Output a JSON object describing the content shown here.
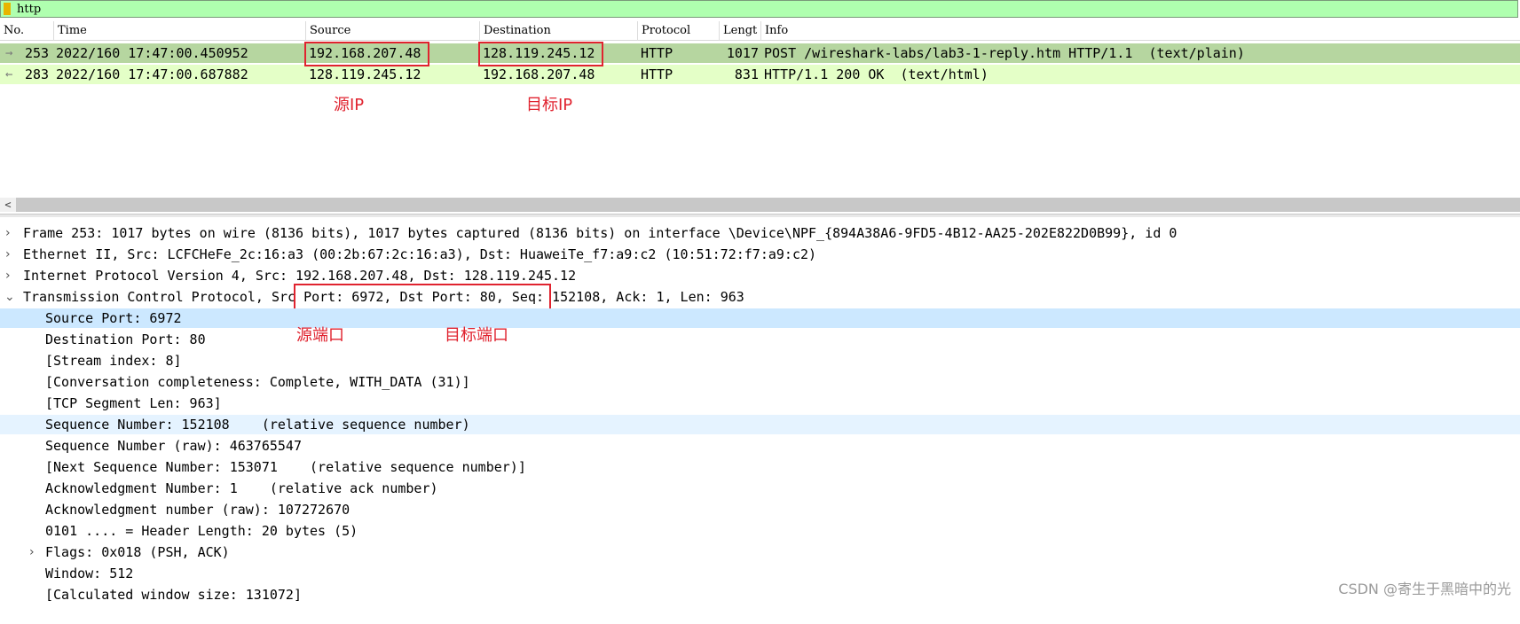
{
  "filter": {
    "text": "http"
  },
  "columns": [
    "No.",
    "Time",
    "Source",
    "Destination",
    "Protocol",
    "Lengt",
    "Info"
  ],
  "packets": [
    {
      "no": "253",
      "time": "2022/160 17:47:00.450952",
      "source": "192.168.207.48",
      "destination": "128.119.245.12",
      "protocol": "HTTP",
      "length": "1017",
      "info": "POST /wireshark-labs/lab3-1-reply.htm HTTP/1.1  (text/plain)"
    },
    {
      "no": "283",
      "time": "2022/160 17:47:00.687882",
      "source": "128.119.245.12",
      "destination": "192.168.207.48",
      "protocol": "HTTP",
      "length": "831",
      "info": "HTTP/1.1 200 OK  (text/html)"
    }
  ],
  "annotations": {
    "src_ip": "源IP",
    "dst_ip": "目标IP",
    "src_port": "源端口",
    "dst_port": "目标端口"
  },
  "details": {
    "frame": "Frame 253: 1017 bytes on wire (8136 bits), 1017 bytes captured (8136 bits) on interface \\Device\\NPF_{894A38A6-9FD5-4B12-AA25-202E822D0B99}, id 0",
    "ethernet": "Ethernet II, Src: LCFCHeFe_2c:16:a3 (00:2b:67:2c:16:a3), Dst: HuaweiTe_f7:a9:c2 (10:51:72:f7:a9:c2)",
    "ip": "Internet Protocol Version 4, Src: 192.168.207.48, Dst: 128.119.245.12",
    "tcp_prefix": "Transmission Control Protocol, ",
    "tcp_ports": "Src Port: 6972, Dst Port: 80",
    "tcp_suffix": ", Seq: 152108, Ack: 1, Len: 963",
    "tcp_fields": [
      "Source Port: 6972",
      "Destination Port: 80",
      "[Stream index: 8]",
      "[Conversation completeness: Complete, WITH_DATA (31)]",
      "[TCP Segment Len: 963]",
      "Sequence Number: 152108    (relative sequence number)",
      "Sequence Number (raw): 463765547",
      "[Next Sequence Number: 153071    (relative sequence number)]",
      "Acknowledgment Number: 1    (relative ack number)",
      "Acknowledgment number (raw): 107272670",
      "0101 .... = Header Length: 20 bytes (5)",
      "Flags: 0x018 (PSH, ACK)",
      "Window: 512",
      "[Calculated window size: 131072]"
    ]
  },
  "watermark": "CSDN @寄生于黑暗中的光"
}
